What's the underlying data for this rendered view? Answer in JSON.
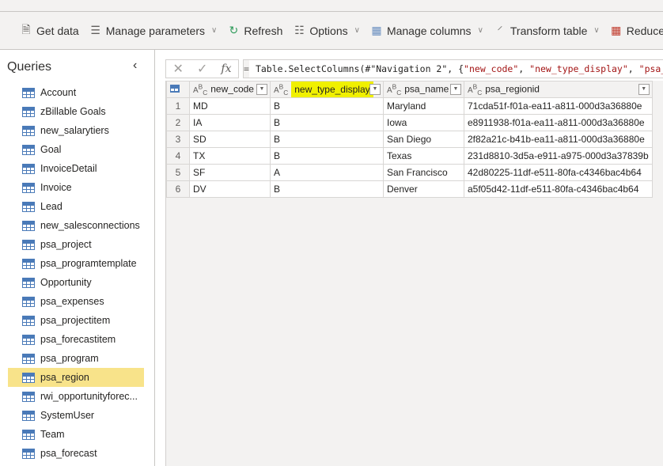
{
  "toolbar": {
    "items": [
      {
        "label": "Get data",
        "icon": "get-data-icon",
        "chevron": false
      },
      {
        "label": "Manage parameters",
        "icon": "parameters-icon",
        "chevron": true
      },
      {
        "label": "Refresh",
        "icon": "refresh-icon",
        "chevron": false
      },
      {
        "label": "Options",
        "icon": "options-icon",
        "chevron": true
      },
      {
        "label": "Manage columns",
        "icon": "columns-icon",
        "chevron": true
      },
      {
        "label": "Transform table",
        "icon": "transform-icon",
        "chevron": true
      },
      {
        "label": "Reduce ro",
        "icon": "reduce-rows-icon",
        "chevron": false
      }
    ]
  },
  "queries": {
    "title": "Queries",
    "selected": "psa_region",
    "items": [
      "Account",
      "zBillable Goals",
      "new_salarytiers",
      "Goal",
      "InvoiceDetail",
      "Invoice",
      "Lead",
      "new_salesconnections",
      "psa_project",
      "psa_programtemplate",
      "Opportunity",
      "psa_expenses",
      "psa_projectitem",
      "psa_forecastitem",
      "psa_program",
      "psa_region",
      "rwi_opportunityforec...",
      "SystemUser",
      "Team",
      "psa_forecast"
    ]
  },
  "formula": {
    "fx": "fx",
    "eq": "=",
    "prefix": "Table.SelectColumns(#\"Navigation 2\", {",
    "s1": "\"new_code\"",
    "s2": "\"new_type_display\"",
    "s3": "\"psa_n"
  },
  "table": {
    "columns": [
      "new_code",
      "new_type_display",
      "psa_name",
      "psa_regionid"
    ],
    "highlighted_column": "new_type_display",
    "highlight_color": "#f0f000",
    "rows": [
      [
        "1",
        "MD",
        "B",
        "Maryland",
        "71cda51f-f01a-ea11-a811-000d3a36880e"
      ],
      [
        "2",
        "IA",
        "B",
        "Iowa",
        "e8911938-f01a-ea11-a811-000d3a36880e"
      ],
      [
        "3",
        "SD",
        "B",
        "San Diego",
        "2f82a21c-b41b-ea11-a811-000d3a36880e"
      ],
      [
        "4",
        "TX",
        "B",
        "Texas",
        "231d8810-3d5a-e911-a975-000d3a37839b"
      ],
      [
        "5",
        "SF",
        "A",
        "San Francisco",
        "42d80225-11df-e511-80fa-c4346bac4b64"
      ],
      [
        "6",
        "DV",
        "B",
        "Denver",
        "a5f05d42-11df-e511-80fa-c4346bac4b64"
      ]
    ]
  }
}
